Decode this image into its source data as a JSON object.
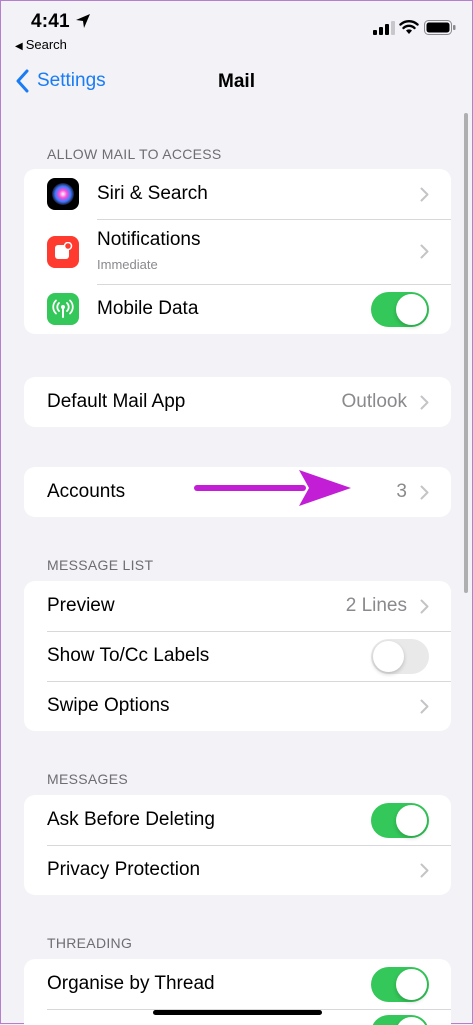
{
  "status_bar": {
    "time": "4:41",
    "back_app": "Search"
  },
  "nav": {
    "back_label": "Settings",
    "title": "Mail"
  },
  "sections": {
    "allow_access": {
      "header": "ALLOW MAIL TO ACCESS",
      "siri": {
        "label": "Siri & Search"
      },
      "notifications": {
        "label": "Notifications",
        "sublabel": "Immediate"
      },
      "mobile_data": {
        "label": "Mobile Data",
        "on": true
      }
    },
    "default_mail": {
      "label": "Default Mail App",
      "value": "Outlook"
    },
    "accounts": {
      "label": "Accounts",
      "value": "3"
    },
    "message_list": {
      "header": "MESSAGE LIST",
      "preview": {
        "label": "Preview",
        "value": "2 Lines"
      },
      "show_to_cc": {
        "label": "Show To/Cc Labels",
        "on": false
      },
      "swipe_options": {
        "label": "Swipe Options"
      }
    },
    "messages": {
      "header": "MESSAGES",
      "ask_before_deleting": {
        "label": "Ask Before Deleting",
        "on": true
      },
      "privacy_protection": {
        "label": "Privacy Protection"
      }
    },
    "threading": {
      "header": "THREADING",
      "organise_by_thread": {
        "label": "Organise by Thread",
        "on": true
      }
    }
  },
  "colors": {
    "accent": "#1a7cf5",
    "toggle_on": "#34c759",
    "annotation_arrow": "#c21ed6",
    "background": "#f2f2f7"
  }
}
